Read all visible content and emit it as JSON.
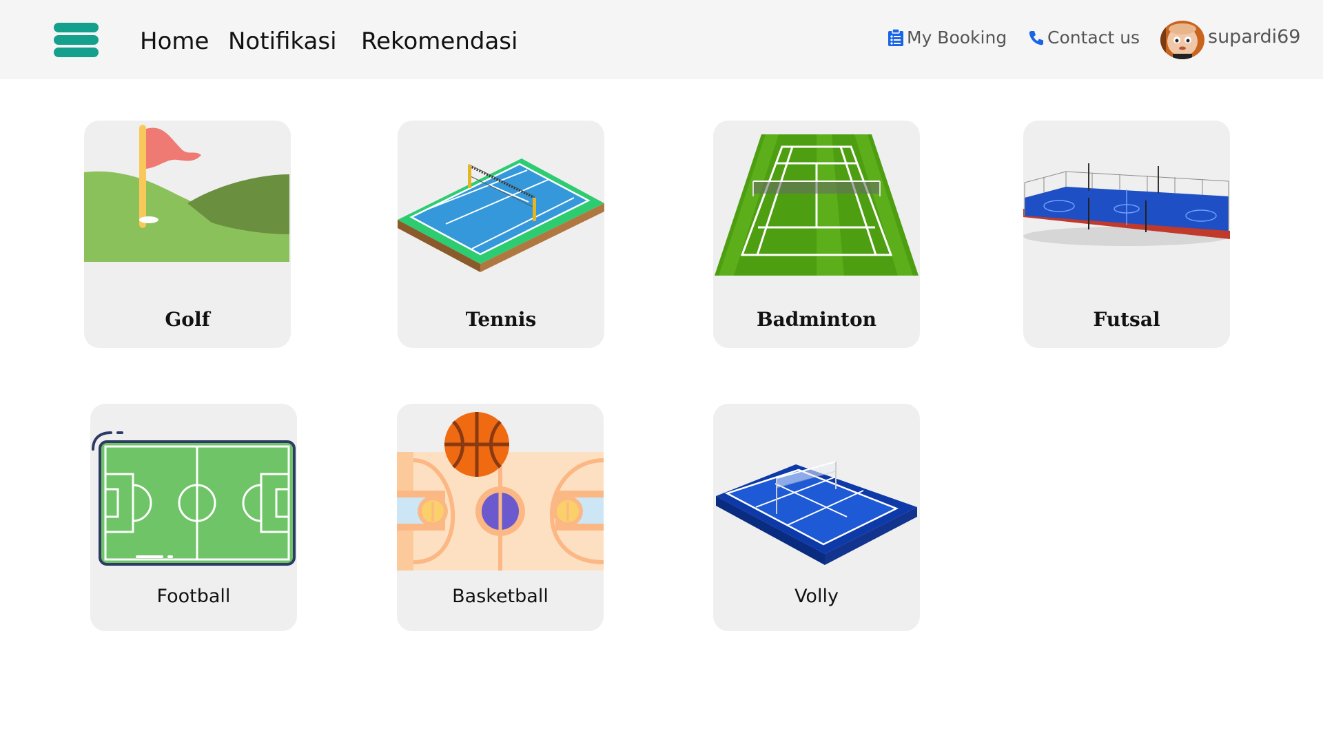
{
  "nav": {
    "menu_icon": "hamburger-menu-icon",
    "links": [
      "Home",
      "Notifikasi",
      "Rekomendasi"
    ],
    "my_booking": {
      "label": "My Booking",
      "icon": "clipboard-icon"
    },
    "contact": {
      "label": "Contact us",
      "icon": "phone-icon"
    },
    "user": {
      "name": "supardi69",
      "avatar_icon": "user-avatar"
    }
  },
  "colors": {
    "accent_teal": "#14a08d",
    "link_blue": "#1a64e8",
    "card_bg": "#efefef",
    "navbar_bg": "#f5f5f5"
  },
  "sports": [
    {
      "label": "Golf",
      "icon": "golf-flag-icon"
    },
    {
      "label": "Tennis",
      "icon": "tennis-court-icon"
    },
    {
      "label": "Badminton",
      "icon": "badminton-court-icon"
    },
    {
      "label": "Futsal",
      "icon": "futsal-court-icon"
    },
    {
      "label": "Football",
      "icon": "football-field-icon"
    },
    {
      "label": "Basketball",
      "icon": "basketball-court-icon"
    },
    {
      "label": "Volly",
      "icon": "volleyball-court-icon"
    }
  ]
}
